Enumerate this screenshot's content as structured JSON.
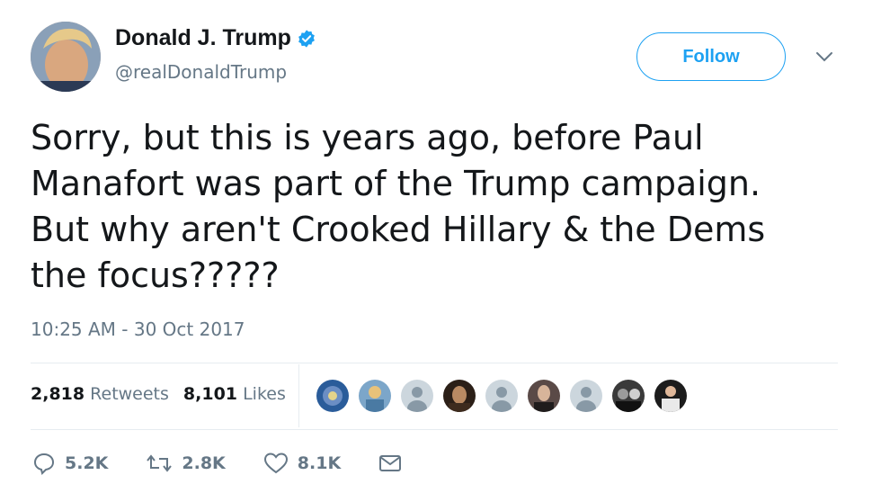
{
  "tweet": {
    "author": {
      "name": "Donald J. Trump",
      "handle": "@realDonaldTrump",
      "verified": true
    },
    "follow_label": "Follow",
    "text": "Sorry, but this is years ago, before Paul\nManafort was part of the Trump campaign.\nBut why aren't Crooked Hillary & the Dems\nthe focus?????",
    "timestamp": "10:25 AM - 30 Oct 2017",
    "stats": {
      "retweets_count": "2,818",
      "retweets_label": "Retweets",
      "likes_count": "8,101",
      "likes_label": "Likes"
    },
    "actions": {
      "replies": "5.2K",
      "retweets": "2.8K",
      "likes": "8.1K"
    }
  },
  "colors": {
    "accent": "#1da1f2",
    "secondary_text": "#657786",
    "border": "#e6ecf0"
  },
  "icons": [
    "verified-badge-icon",
    "chevron-down-icon",
    "reply-icon",
    "retweet-icon",
    "heart-icon",
    "message-icon"
  ]
}
